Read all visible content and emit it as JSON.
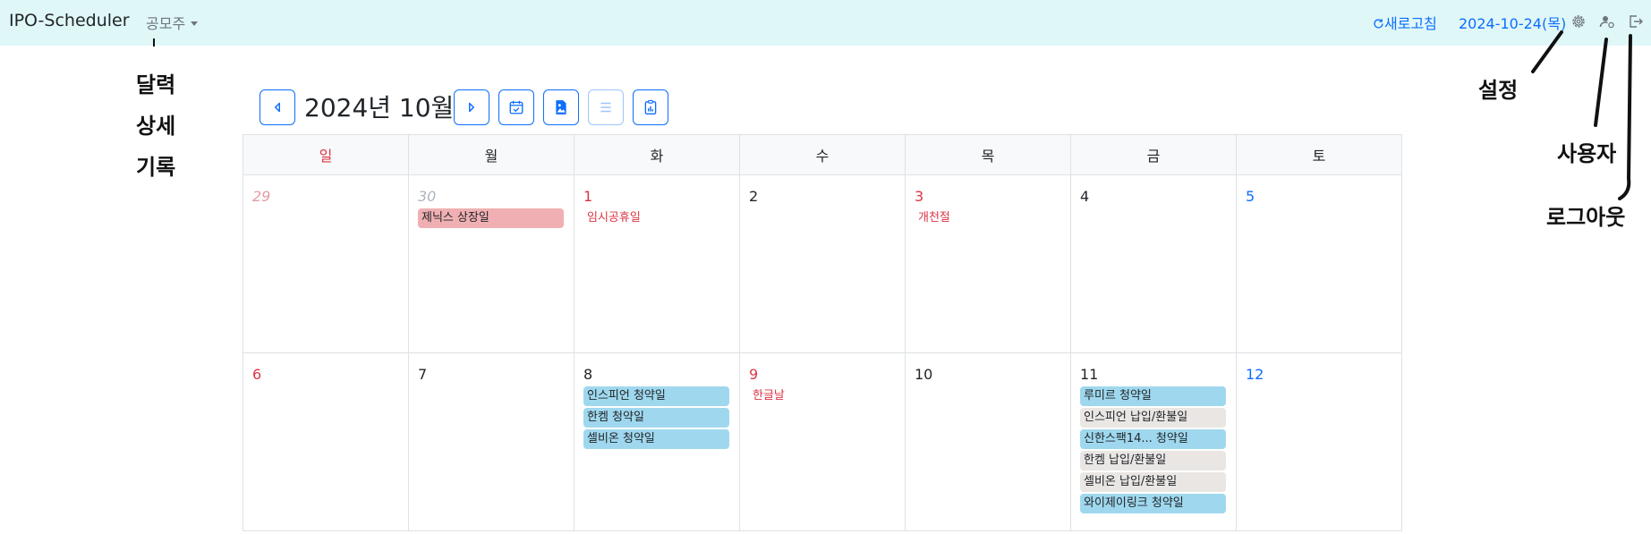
{
  "navbar": {
    "brand": "IPO-Scheduler",
    "menu": "공모주",
    "refresh": "새로고침",
    "date": "2024-10-24(목)",
    "icons": [
      "gear-icon",
      "user-gear-icon",
      "logout-icon"
    ]
  },
  "annotations": {
    "calendar": "달력",
    "detail": "상세",
    "record": "기록",
    "settings": "설정",
    "user": "사용자",
    "logout": "로그아웃"
  },
  "toolbar": {
    "month_title": "2024년 10월",
    "buttons": [
      "prev-month",
      "next-month",
      "today",
      "image",
      "list",
      "report"
    ]
  },
  "calendar": {
    "weekdays": [
      "일",
      "월",
      "화",
      "수",
      "목",
      "금",
      "토"
    ],
    "weeks": [
      [
        {
          "day": "29",
          "events": []
        },
        {
          "day": "30",
          "events": [
            {
              "label": "제닉스 상장일",
              "kind": "listing"
            }
          ]
        },
        {
          "day": "1",
          "holiday": "임시공휴일",
          "events": []
        },
        {
          "day": "2",
          "events": []
        },
        {
          "day": "3",
          "holiday": "개천절",
          "events": []
        },
        {
          "day": "4",
          "events": []
        },
        {
          "day": "5",
          "events": []
        }
      ],
      [
        {
          "day": "6",
          "events": []
        },
        {
          "day": "7",
          "events": []
        },
        {
          "day": "8",
          "events": [
            {
              "label": "인스피언 청약일",
              "kind": "subscription"
            },
            {
              "label": "한켐 청약일",
              "kind": "subscription"
            },
            {
              "label": "셀비온 청약일",
              "kind": "subscription"
            }
          ]
        },
        {
          "day": "9",
          "holiday": "한글날",
          "events": []
        },
        {
          "day": "10",
          "events": []
        },
        {
          "day": "11",
          "events": [
            {
              "label": "루미르 청약일",
              "kind": "subscription"
            },
            {
              "label": "인스피언 납입/환불일",
              "kind": "payment"
            },
            {
              "label": "신한스팩14... 청약일",
              "kind": "subscription"
            },
            {
              "label": "한켐 납입/환불일",
              "kind": "payment"
            },
            {
              "label": "셀비온 납입/환불일",
              "kind": "payment"
            },
            {
              "label": "와이제이링크 청약일",
              "kind": "subscription"
            }
          ]
        },
        {
          "day": "12",
          "events": []
        }
      ]
    ]
  },
  "colors": {
    "navbar_bg": "#e0f7f8",
    "accent": "#0d6efd",
    "sunday": "#dc3545",
    "saturday": "#0d6efd",
    "subscription": "#9fd8ee",
    "payment": "#e9e6e4",
    "listing": "#f0b0b3"
  }
}
